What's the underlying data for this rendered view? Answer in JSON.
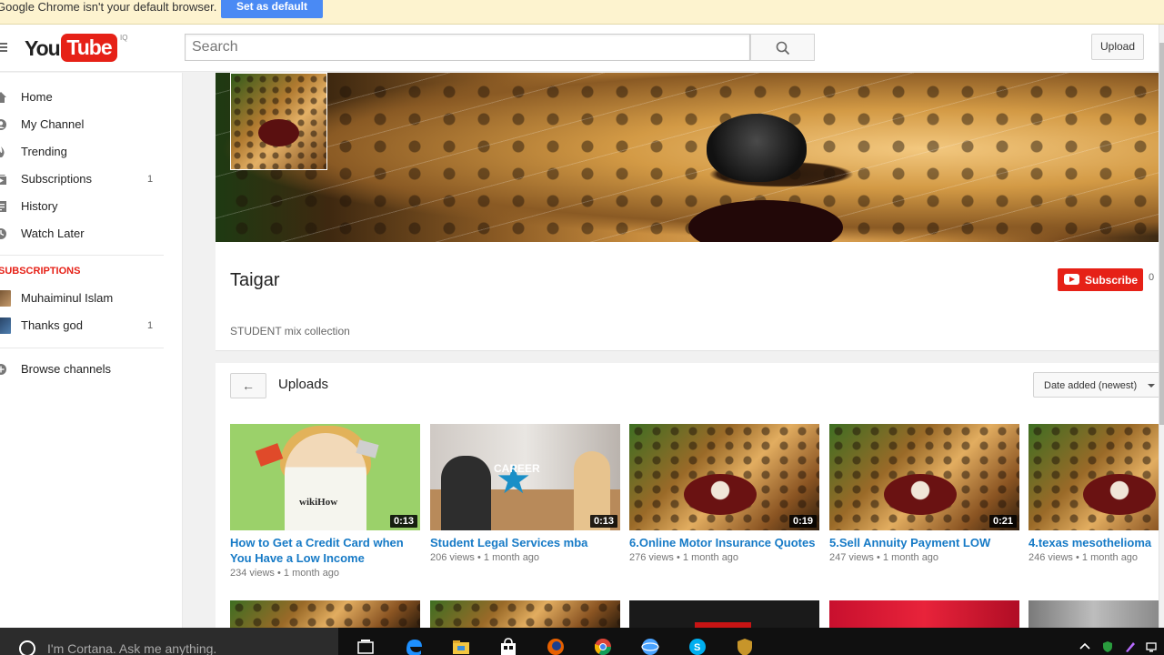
{
  "infobar": {
    "message": "Google Chrome isn't your default browser.",
    "button_label": "Set as default"
  },
  "masthead": {
    "logo_you": "You",
    "logo_tube": "Tube",
    "logo_country": "IQ",
    "search_placeholder": "Search",
    "upload_label": "Upload"
  },
  "sidebar": {
    "items": [
      {
        "label": "Home",
        "icon": "home-icon"
      },
      {
        "label": "My Channel",
        "icon": "user-icon"
      },
      {
        "label": "Trending",
        "icon": "flame-icon"
      },
      {
        "label": "Subscriptions",
        "icon": "subscriptions-icon",
        "count": "1"
      },
      {
        "label": "History",
        "icon": "history-icon"
      },
      {
        "label": "Watch Later",
        "icon": "clock-icon"
      }
    ],
    "subscriptions_heading": "SUBSCRIPTIONS",
    "subscriptions": [
      {
        "label": "Muhaiminul Islam"
      },
      {
        "label": "Thanks god",
        "count": "1"
      }
    ],
    "browse_label": "Browse channels"
  },
  "channel": {
    "name": "Taigar",
    "description": "STUDENT mix collection",
    "subscribe_label": "Subscribe",
    "subscriber_count": "0"
  },
  "uploads": {
    "title": "Uploads",
    "sort_label": "Date added (newest)",
    "videos": [
      {
        "title": "How to Get a Credit Card when You Have a Low Income",
        "duration": "0:13",
        "views": "234 views",
        "age": "1 month ago",
        "thumb": "wikihow"
      },
      {
        "title": "Student Legal Services mba",
        "duration": "0:13",
        "views": "206 views",
        "age": "1 month ago",
        "thumb": "career"
      },
      {
        "title": "6.Online Motor Insurance Quotes",
        "duration": "0:19",
        "views": "276 views",
        "age": "1 month ago",
        "thumb": "leopard"
      },
      {
        "title": "5.Sell Annuity Payment LOW",
        "duration": "0:21",
        "views": "247 views",
        "age": "1 month ago",
        "thumb": "leopard"
      },
      {
        "title": "4.texas mesothelioma",
        "duration": "",
        "views": "246 views",
        "age": "1 month ago",
        "thumb": "leopard"
      }
    ]
  },
  "taskbar": {
    "cortana_placeholder": "I'm Cortana. Ask me anything."
  },
  "colors": {
    "youtube_red": "#e62117",
    "link_blue": "#167ac6",
    "chrome_blue": "#4a8af4"
  }
}
